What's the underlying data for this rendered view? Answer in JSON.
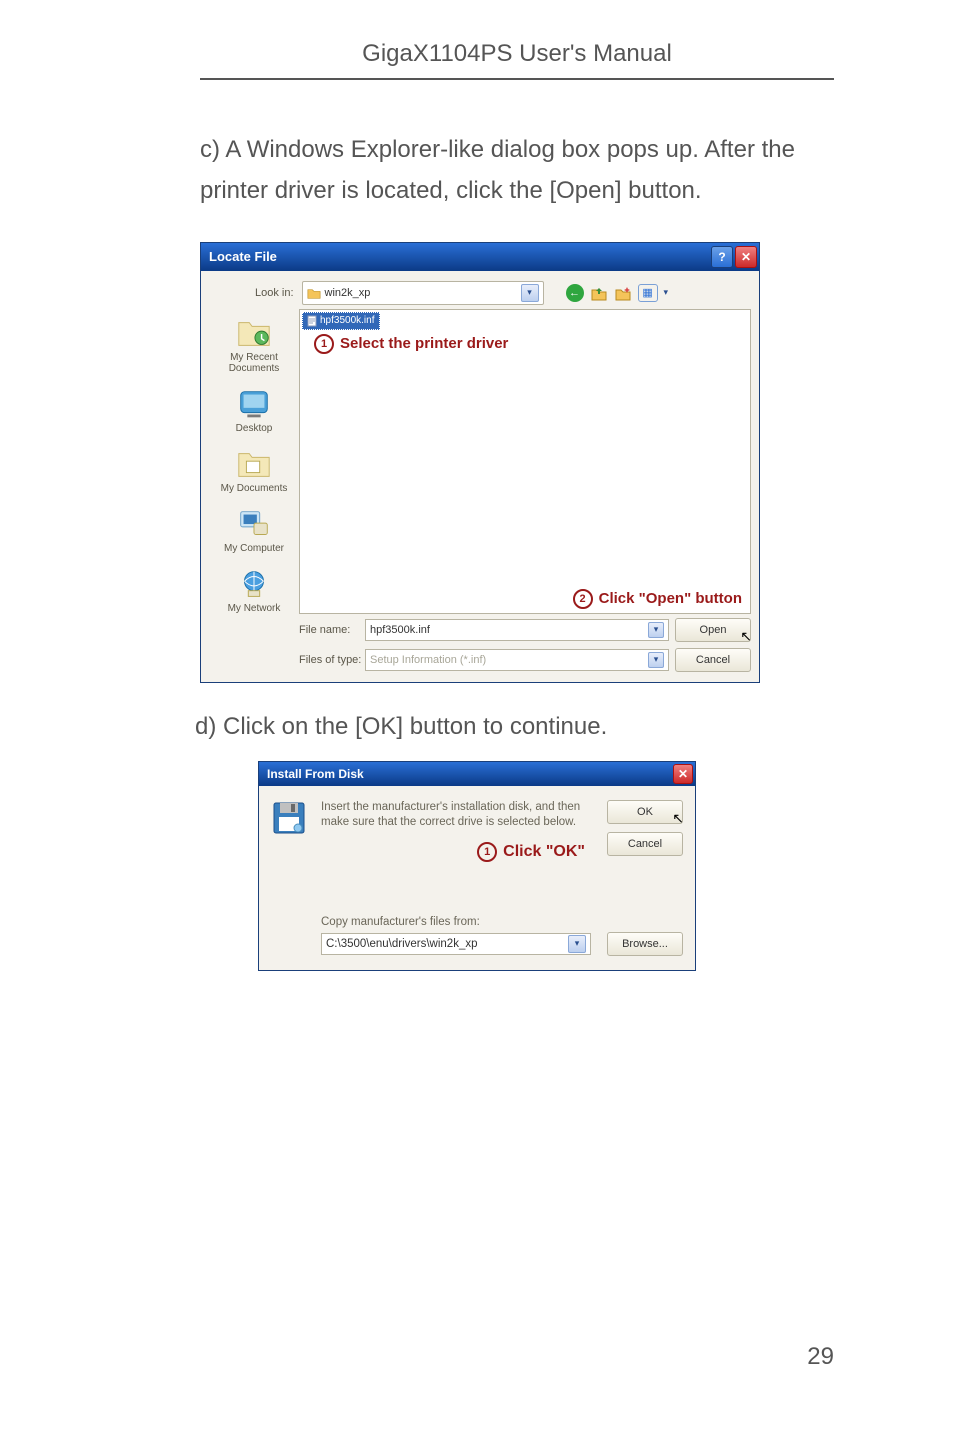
{
  "header": {
    "title": "GigaX1104PS User's Manual"
  },
  "text": {
    "para_c": "c) A Windows Explorer-like dialog box pops up. After the printer driver is located, click the [Open] button.",
    "para_d": "d) Click on the  [OK] button to continue."
  },
  "locate_file": {
    "window_title": "Locate File",
    "help_button": "?",
    "close_button": "✕",
    "lookin_label": "Look in:",
    "lookin_value": "win2k_xp",
    "toolbar": {
      "back": "←",
      "up": "↑",
      "new": "✧",
      "views": "▦",
      "menu": "▾"
    },
    "selected_file": "hpf3500k.inf",
    "annotation1": {
      "num": "1",
      "text": "Select the printer driver"
    },
    "annotation2": {
      "num": "2",
      "text": "Click \"Open\" button"
    },
    "places": {
      "recent_l1": "My Recent",
      "recent_l2": "Documents",
      "desktop": "Desktop",
      "documents": "My Documents",
      "computer": "My Computer",
      "network": "My Network"
    },
    "filename_label": "File name:",
    "filename_value": "hpf3500k.inf",
    "filetype_label": "Files of type:",
    "filetype_value": "Setup Information (*.inf)",
    "open_btn": "Open",
    "cancel_btn": "Cancel"
  },
  "install_from_disk": {
    "window_title": "Install From Disk",
    "close_button": "✕",
    "message": "Insert the manufacturer's installation disk, and then make sure that the correct drive is selected below.",
    "ok_btn": "OK",
    "cancel_btn": "Cancel",
    "annotation": {
      "num": "1",
      "text": "Click \"OK\""
    },
    "copy_label": "Copy manufacturer's files from:",
    "path_value": "C:\\3500\\enu\\drivers\\win2k_xp",
    "browse_btn": "Browse..."
  },
  "page_number": "29"
}
